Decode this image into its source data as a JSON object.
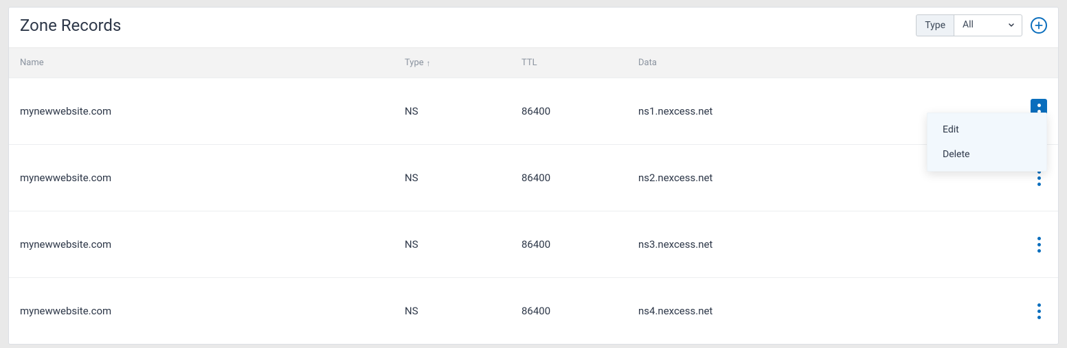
{
  "panel": {
    "title": "Zone Records"
  },
  "filter": {
    "label": "Type",
    "selected": "All"
  },
  "columns": {
    "name": "Name",
    "type": "Type",
    "ttl": "TTL",
    "data": "Data"
  },
  "rows": [
    {
      "name": "mynewwebsite.com",
      "type": "NS",
      "ttl": "86400",
      "data": "ns1.nexcess.net",
      "menu_open": true
    },
    {
      "name": "mynewwebsite.com",
      "type": "NS",
      "ttl": "86400",
      "data": "ns2.nexcess.net",
      "menu_open": false
    },
    {
      "name": "mynewwebsite.com",
      "type": "NS",
      "ttl": "86400",
      "data": "ns3.nexcess.net",
      "menu_open": false
    },
    {
      "name": "mynewwebsite.com",
      "type": "NS",
      "ttl": "86400",
      "data": "ns4.nexcess.net",
      "menu_open": false
    }
  ],
  "menu": {
    "edit": "Edit",
    "delete": "Delete"
  }
}
